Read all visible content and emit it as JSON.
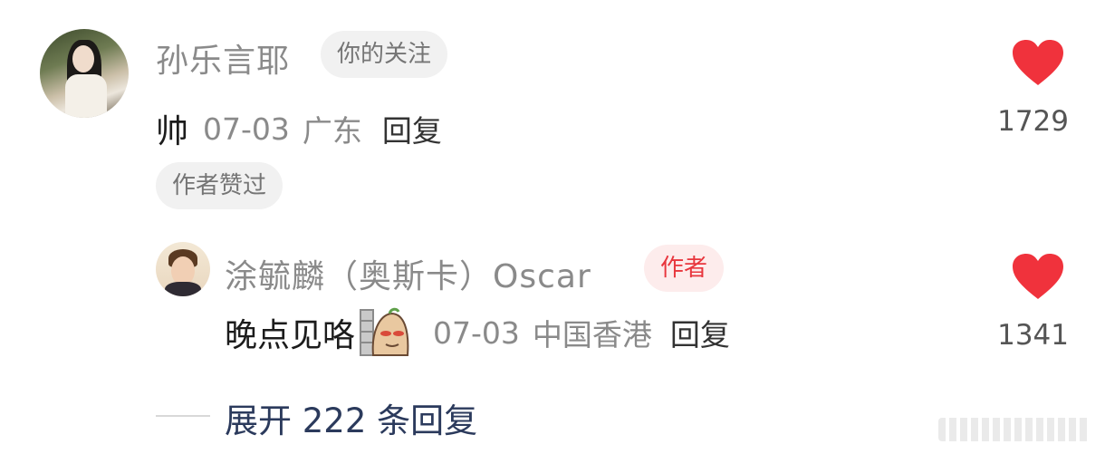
{
  "comment": {
    "username": "孙乐言耶",
    "follow_tag": "你的关注",
    "text": "帅",
    "date": "07-03",
    "location": "广东",
    "reply_label": "回复",
    "author_liked_tag": "作者赞过",
    "like_count": "1729"
  },
  "reply": {
    "username": "涂毓麟（奥斯卡）Oscar",
    "author_tag": "作者",
    "text": "晚点见咯",
    "date": "07-03",
    "location": "中国香港",
    "reply_label": "回复",
    "like_count": "1341"
  },
  "expand": {
    "label": "展开 222 条回复"
  },
  "colors": {
    "heart": "#f0323c",
    "author_tag_text": "#e8363d",
    "expand_text": "#2b3a5c"
  }
}
